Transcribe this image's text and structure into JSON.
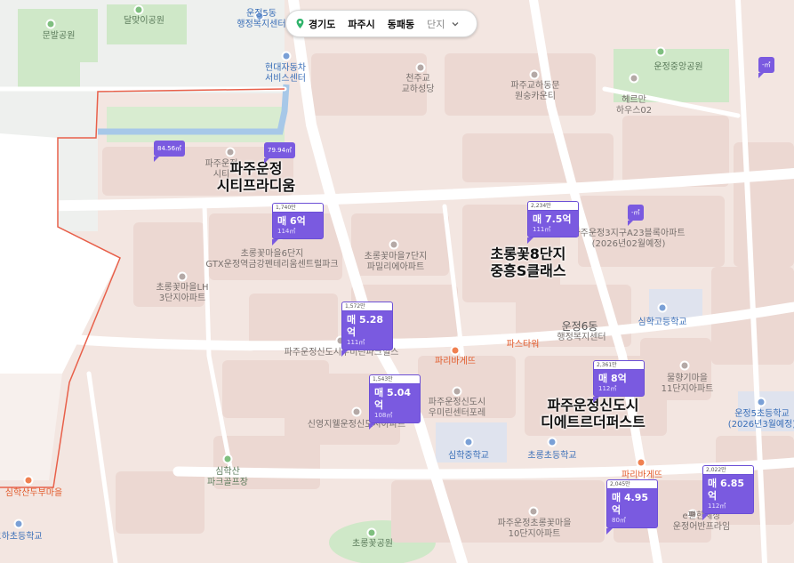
{
  "breadcrumb": {
    "province": "경기도",
    "city": "파주시",
    "district": "동패동",
    "type": "단지"
  },
  "big_labels": {
    "citiprarium_1": "파주운정",
    "citiprarium_2": "시티프라디움",
    "chorong8_1": "초롱꽃8단지",
    "chorong8_2": "중흥S클래스",
    "design_1": "파주운정신도시",
    "design_2": "디에트르더퍼스트"
  },
  "labels": {
    "dalmaji_park": "달맞이공원",
    "munbal_park": "문발공원",
    "unjeong5_1": "운정5동",
    "unjeong5_2": "행정복지센터",
    "hyundai_1": "현대자동차",
    "hyundai_2": "서비스센터",
    "church_1": "천주교",
    "church_2": "교하성당",
    "kyoha_1": "파주교하동문",
    "kyoha_2": "원숭카운티",
    "herman_1": "헤르만",
    "herman_2": "하우스02",
    "unjeong_central_park": "운정중앙공원",
    "fillupsiterm": "파주운정",
    "fillupsiterm_2": "시티",
    "a23_1": "파주운정3지구A23블록아파트",
    "a23_2": "(2026년02월예정)",
    "chorong6_1": "초롱꽃마을6단지",
    "chorong6_2": "GTX운정역금강펜테리움센트럴파크",
    "chorong7_1": "초롱꽃마을7단지",
    "chorong7_2": "파밀리에아파트",
    "chorongLH_1": "초롱꽃마을LH",
    "chorongLH_2": "3단지아파트",
    "unjeong6_1": "운정6동",
    "unjeong6_2": "행정복지센터",
    "simhak_high": "심학고등학교",
    "paris_tower": "파스타워",
    "paris_baguette": "파리바게뜨",
    "woomirin_park": "파주운정신도시우미린파크힐스",
    "mulhyanggi_1": "물향기마을",
    "mulhyanggi_2": "11단지아파트",
    "unjeong5_school_1": "운정5초등학교",
    "unjeong5_school_2": "(2026년3월예정)",
    "woomirin_center_1": "파주운정신도시",
    "woomirin_center_2": "우미린센터포레",
    "sinyoung_apt": "신영지웰운정신도시아파트",
    "simhak_middle": "심학중학교",
    "chorong_elem": "초롱초등학교",
    "simhak_golf_1": "심학산",
    "simhak_golf_2": "파크골프장",
    "dubu_village": "심학산두부마을",
    "gyoha_elem": "교하초등학교",
    "chorong10_1": "파주운정초롱꽃마을",
    "chorong10_2": "10단지아파트",
    "paris_baguette2": "파리바게뜨",
    "epyeonhan_1": "e편한세상",
    "epyeonhan_2": "운정어반프라임",
    "chorong_park": "초롱꽃공원"
  },
  "markers": [
    {
      "id": "m1",
      "count": "1,740만",
      "price": "매 6억",
      "area": "114㎡"
    },
    {
      "id": "m2",
      "count": "2,234만",
      "price": "매 7.5억",
      "area": "111㎡"
    },
    {
      "id": "m3",
      "count": "1,572만",
      "price": "매 5.28억",
      "area": "111㎡"
    },
    {
      "id": "m4",
      "count": "1,543만",
      "price": "매 5.04억",
      "area": "108㎡"
    },
    {
      "id": "m5",
      "count": "2,361만",
      "price": "매 8억",
      "area": "112㎡"
    },
    {
      "id": "m6",
      "count": "2,045만",
      "price": "매 4.95억",
      "area": "80㎡"
    },
    {
      "id": "m7",
      "count": "2,022만",
      "price": "매 6.85억",
      "area": "112㎡"
    }
  ],
  "mini_markers": {
    "a": "84.56㎡",
    "b": "79.94㎡",
    "c": "-㎡",
    "d": "-㎡"
  },
  "colors": {
    "marker": "#7a5ae0",
    "road": "#ffffff",
    "block": "#ead6d0",
    "park": "#cfe8c8",
    "water": "#a7c8e8",
    "boundary": "#e8604a"
  }
}
